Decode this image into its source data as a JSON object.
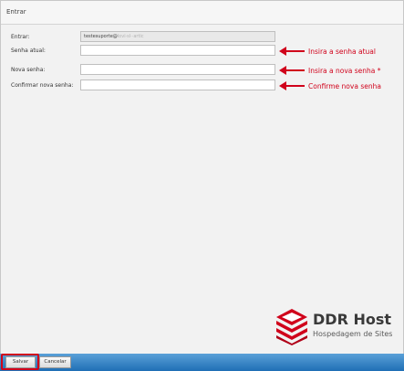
{
  "window": {
    "title": "Entrar"
  },
  "form": {
    "login": {
      "label": "Entrar:",
      "value_prefix": "testesuporte@",
      "value_obscured": "lovi·sl··artic"
    },
    "current_password": {
      "label": "Senha atual:",
      "value": ""
    },
    "new_password": {
      "label": "Nova senha:",
      "value": ""
    },
    "confirm_password": {
      "label": "Confirmar nova senha:",
      "value": ""
    }
  },
  "annotations": {
    "current_password": "Insira a senha atual",
    "new_password": "Insira a nova senha *",
    "confirm_password": "Confirme nova senha",
    "color": "#d0021b"
  },
  "logo": {
    "name": "DDR Host",
    "tagline": "Hospedagem de Sites",
    "icon": "stacked-layers-icon",
    "color": "#d0021b"
  },
  "footer": {
    "save_label": "Salvar",
    "cancel_label": "Cancelar",
    "bar_color": "#1f6fb5"
  }
}
